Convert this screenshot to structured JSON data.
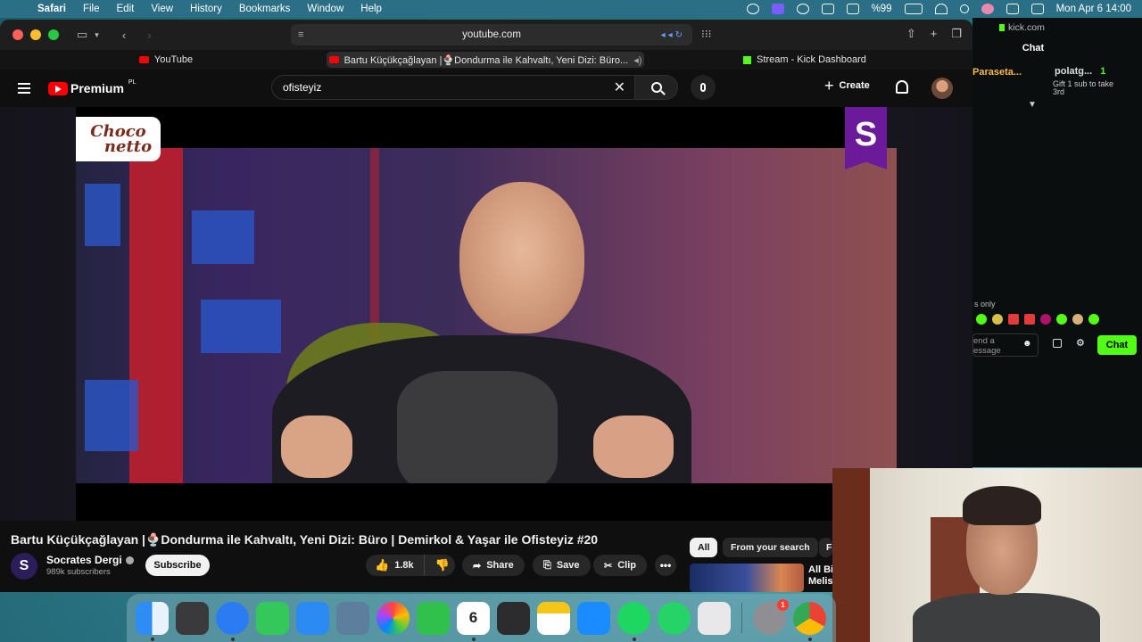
{
  "menubar": {
    "app": "Safari",
    "items": [
      "File",
      "Edit",
      "View",
      "History",
      "Bookmarks",
      "Window",
      "Help"
    ],
    "battery": "%99",
    "datetime": "Mon Apr 6  14:00"
  },
  "browser": {
    "url": "youtube.com",
    "tabs": [
      {
        "label": "YouTube"
      },
      {
        "label": "Bartu Küçükçağlayan |🍨Dondurma ile Kahvaltı, Yeni Dizi: Büro..."
      },
      {
        "label": "Stream - Kick Dashboard"
      }
    ]
  },
  "youtube": {
    "logo_text": "Premium",
    "logo_region": "PL",
    "search_value": "ofisteyiz",
    "create_label": "Create",
    "video_title": "Bartu Küçükçağlayan |🍨Dondurma ile Kahvaltı, Yeni Dizi: Büro | Demirkol & Yaşar ile Ofisteyiz #20",
    "channel_initial": "S",
    "channel_name": "Socrates Dergi",
    "subscribers": "989k subscribers",
    "subscribe_label": "Subscribe",
    "likes": "1.8k",
    "share_label": "Share",
    "save_label": "Save",
    "clip_label": "Clip",
    "more_label": "•••",
    "chips": [
      "All",
      "From your search",
      "F"
    ],
    "reco_title_line1": "All Bi",
    "reco_title_line2": "Melis",
    "video_overlay_brand_line1": "Choco",
    "video_overlay_brand_line2": "netto",
    "channel_badge": "S"
  },
  "kick": {
    "url": "kick.com",
    "chat_header": "Chat",
    "msg1_user": "Paraseta...",
    "msg2_user": "polatg...",
    "msg2_count": "1",
    "msg2_text": "Gift 1 sub to take 3rd",
    "subs_only": "s only",
    "input_placeholder_line1": "end a",
    "input_placeholder_line2": "essage",
    "send_label": "Chat"
  },
  "dock": {
    "calendar_day": "6",
    "settings_badge": "1",
    "apps": [
      "finder-icon",
      "launchpad-icon",
      "safari-icon",
      "messages-icon",
      "mail-icon",
      "preview-icon",
      "photos-icon",
      "facetime-icon",
      "calendar-icon",
      "reminders-icon",
      "notes-icon",
      "app-store-icon",
      "spotify-icon",
      "whatsapp-icon",
      "files-icon",
      "system-settings-icon",
      "chrome-icon"
    ]
  },
  "colors": {
    "youtube_red": "#ff0000",
    "kick_green": "#53fc18",
    "yt_bg": "#0f0f0f"
  }
}
